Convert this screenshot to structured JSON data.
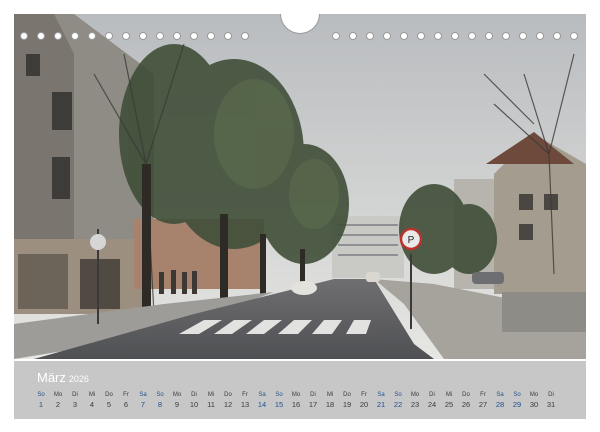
{
  "calendar": {
    "month": "März",
    "year": "2026",
    "days": [
      {
        "name": "So",
        "num": "1",
        "type": "sun"
      },
      {
        "name": "Mo",
        "num": "2",
        "type": "wd"
      },
      {
        "name": "Di",
        "num": "3",
        "type": "wd"
      },
      {
        "name": "Mi",
        "num": "4",
        "type": "wd"
      },
      {
        "name": "Do",
        "num": "5",
        "type": "wd"
      },
      {
        "name": "Fr",
        "num": "6",
        "type": "wd"
      },
      {
        "name": "Sa",
        "num": "7",
        "type": "sat"
      },
      {
        "name": "So",
        "num": "8",
        "type": "sun"
      },
      {
        "name": "Mo",
        "num": "9",
        "type": "wd"
      },
      {
        "name": "Di",
        "num": "10",
        "type": "wd"
      },
      {
        "name": "Mi",
        "num": "11",
        "type": "wd"
      },
      {
        "name": "Do",
        "num": "12",
        "type": "wd"
      },
      {
        "name": "Fr",
        "num": "13",
        "type": "wd"
      },
      {
        "name": "Sa",
        "num": "14",
        "type": "sat"
      },
      {
        "name": "So",
        "num": "15",
        "type": "sun"
      },
      {
        "name": "Mo",
        "num": "16",
        "type": "wd"
      },
      {
        "name": "Di",
        "num": "17",
        "type": "wd"
      },
      {
        "name": "Mi",
        "num": "18",
        "type": "wd"
      },
      {
        "name": "Do",
        "num": "19",
        "type": "wd"
      },
      {
        "name": "Fr",
        "num": "20",
        "type": "wd"
      },
      {
        "name": "Sa",
        "num": "21",
        "type": "sat"
      },
      {
        "name": "So",
        "num": "22",
        "type": "sun"
      },
      {
        "name": "Mo",
        "num": "23",
        "type": "wd"
      },
      {
        "name": "Di",
        "num": "24",
        "type": "wd"
      },
      {
        "name": "Mi",
        "num": "25",
        "type": "wd"
      },
      {
        "name": "Do",
        "num": "26",
        "type": "wd"
      },
      {
        "name": "Fr",
        "num": "27",
        "type": "wd"
      },
      {
        "name": "Sa",
        "num": "28",
        "type": "sat"
      },
      {
        "name": "So",
        "num": "29",
        "type": "sun"
      },
      {
        "name": "Mo",
        "num": "30",
        "type": "wd"
      },
      {
        "name": "Di",
        "num": "31",
        "type": "wd"
      }
    ]
  },
  "colors": {
    "calendar_bar": "#c7c7c7",
    "weekday_text": "#3a3a3a",
    "weekend_text": "#1f4f8f",
    "month_text": "#ffffff"
  }
}
